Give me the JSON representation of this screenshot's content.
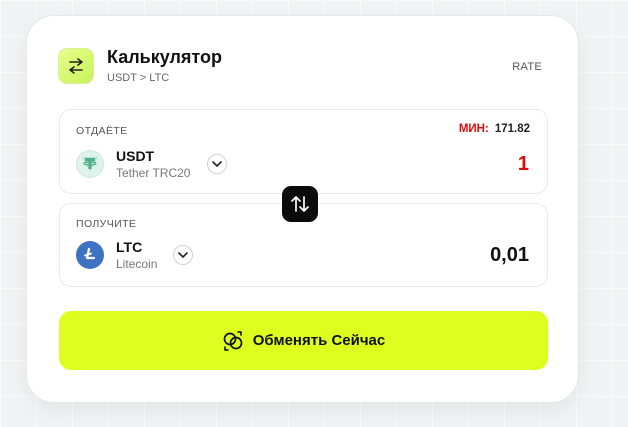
{
  "header": {
    "title": "Калькулятор",
    "subtitle": "USDT > LTC",
    "rate_label": "RATE",
    "icon": "swap-arrows-icon"
  },
  "give": {
    "label": "ОТДАЁТЕ",
    "min_label": "МИН:",
    "min_value": "171.82",
    "ticker": "USDT",
    "network": "Tether TRC20",
    "amount": "1",
    "icon": "tether-icon",
    "amount_color": "#e00b0b"
  },
  "receive": {
    "label": "ПОЛУЧИТЕ",
    "ticker": "LTC",
    "network": "Litecoin",
    "amount": "0,01",
    "icon": "litecoin-icon"
  },
  "swap_button": {
    "icon": "swap-vertical-icon"
  },
  "exchange_button": {
    "label": "Обменять Сейчас",
    "icon": "exchange-rings-icon",
    "color": "#ddff1f"
  },
  "colors": {
    "accent": "#ddff1f",
    "danger": "#e00b0b"
  }
}
